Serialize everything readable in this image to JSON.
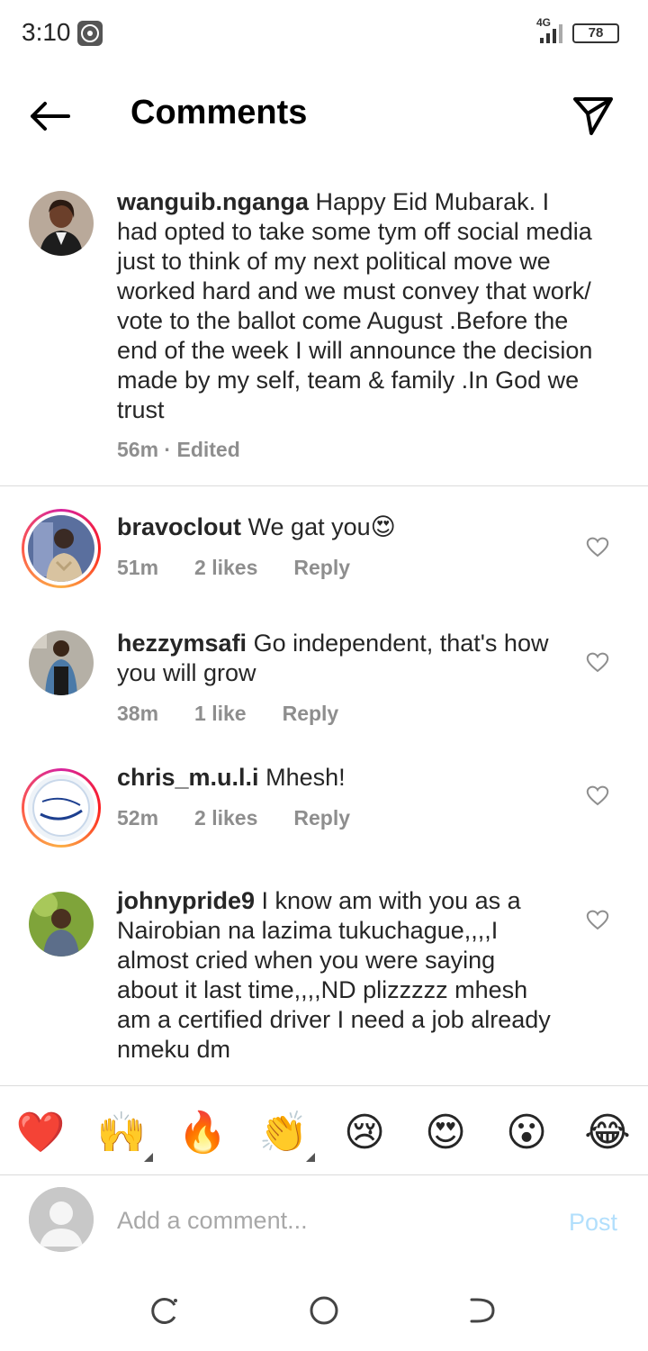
{
  "status_bar": {
    "time": "3:10",
    "network": "4G",
    "battery": "78"
  },
  "header": {
    "title": "Comments",
    "back_icon": "arrow-left-icon",
    "send_icon": "paper-plane-icon"
  },
  "caption": {
    "username": "wanguib.nganga",
    "text": "Happy Eid Mubarak. I had opted to take some tym off social media just to think of my next political move we worked hard and we must convey that work/ vote to the ballot come August .Before the end of the week I will announce the decision made by my self, team & family .In God we trust",
    "meta": "56m · Edited"
  },
  "comments": [
    {
      "username": "bravoclout",
      "text": "We gat you😍",
      "time": "51m",
      "likes": "2 likes",
      "reply": "Reply"
    },
    {
      "username": "hezzymsafi",
      "text": "Go independent, that's how you will grow",
      "time": "38m",
      "likes": "1 like",
      "reply": "Reply"
    },
    {
      "username": "chris_m.u.l.i",
      "text": "Mhesh!",
      "time": "52m",
      "likes": "2 likes",
      "reply": "Reply"
    },
    {
      "username": "johnypride9",
      "text": "I know am with you as a Nairobian na lazima tukuchague,,,,I almost cried when you were saying about it last time,,,,ND plizzzzz mhesh am a certified driver I need a job already nmeku dm",
      "time": "",
      "likes": "",
      "reply": ""
    }
  ],
  "emoji_bar": [
    "❤️",
    "🙌",
    "🔥",
    "👏",
    "😢",
    "😍",
    "😮",
    "😂"
  ],
  "input": {
    "placeholder": "Add a comment...",
    "post_label": "Post"
  },
  "colors": {
    "post_disabled": "#b2dffc",
    "meta_grey": "#8e8e8e",
    "divider": "#dbdbdb"
  }
}
